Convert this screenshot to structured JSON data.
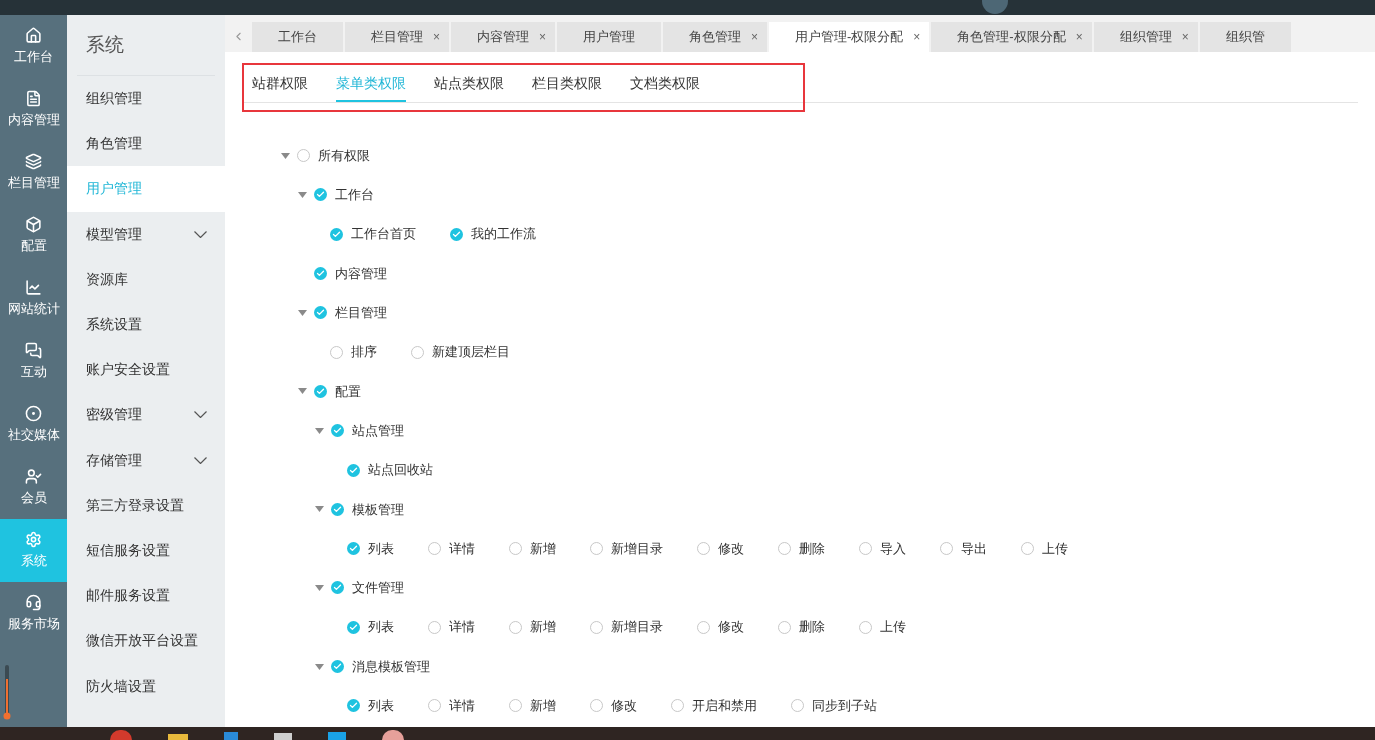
{
  "icon_rail": [
    {
      "label": "工作台",
      "selected": false
    },
    {
      "label": "内容管理",
      "selected": false
    },
    {
      "label": "栏目管理",
      "selected": false
    },
    {
      "label": "配置",
      "selected": false
    },
    {
      "label": "网站统计",
      "selected": false
    },
    {
      "label": "互动",
      "selected": false
    },
    {
      "label": "社交媒体",
      "selected": false
    },
    {
      "label": "会员",
      "selected": false
    },
    {
      "label": "系统",
      "selected": true
    },
    {
      "label": "服务市场",
      "selected": false
    }
  ],
  "sidebar": {
    "title": "系统",
    "items": [
      {
        "label": "组织管理",
        "selected": false
      },
      {
        "label": "角色管理",
        "selected": false
      },
      {
        "label": "用户管理",
        "selected": true
      },
      {
        "label": "模型管理",
        "selected": false,
        "expanded": false
      },
      {
        "label": "资源库",
        "selected": false
      },
      {
        "label": "系统设置",
        "selected": false
      },
      {
        "label": "账户安全设置",
        "selected": false
      },
      {
        "label": "密级管理",
        "selected": false,
        "expanded": false
      },
      {
        "label": "存储管理",
        "selected": false,
        "expanded": false
      },
      {
        "label": "第三方登录设置",
        "selected": false
      },
      {
        "label": "短信服务设置",
        "selected": false
      },
      {
        "label": "邮件服务设置",
        "selected": false
      },
      {
        "label": "微信开放平台设置",
        "selected": false
      },
      {
        "label": "防火墙设置",
        "selected": false
      }
    ]
  },
  "tabs": [
    {
      "label": "工作台",
      "selected": false
    },
    {
      "label": "栏目管理",
      "close": "×",
      "selected": false
    },
    {
      "label": "内容管理",
      "close": "×",
      "selected": false
    },
    {
      "label": "用户管理",
      "selected": false
    },
    {
      "label": "角色管理",
      "close": "×",
      "selected": false
    },
    {
      "label": "用户管理-权限分配",
      "close": "×",
      "selected": true
    },
    {
      "label": "角色管理-权限分配",
      "close": "×",
      "selected": false
    },
    {
      "label": "组织管理",
      "close": "×",
      "selected": false
    },
    {
      "label": "组织管",
      "selected": false
    }
  ],
  "subtabs": [
    {
      "label": "站群权限",
      "selected": false
    },
    {
      "label": "菜单类权限",
      "selected": true
    },
    {
      "label": "站点类权限",
      "selected": false
    },
    {
      "label": "栏目类权限",
      "selected": false
    },
    {
      "label": "文档类权限",
      "selected": false
    }
  ],
  "tree": [
    {
      "label": "所有权限",
      "checked": false,
      "expanded": true,
      "children": [
        {
          "label": "工作台",
          "checked": true,
          "expanded": true,
          "children": [
            {
              "label": "工作台首页",
              "checked": true
            },
            {
              "label": "我的工作流",
              "checked": true
            }
          ]
        },
        {
          "label": "内容管理",
          "checked": true
        },
        {
          "label": "栏目管理",
          "checked": true,
          "expanded": true,
          "children": [
            {
              "label": "排序",
              "checked": false
            },
            {
              "label": "新建顶层栏目",
              "checked": false
            }
          ]
        },
        {
          "label": "配置",
          "checked": true,
          "expanded": true,
          "children": [
            {
              "label": "站点管理",
              "checked": true,
              "expanded": true,
              "children": [
                {
                  "label": "站点回收站",
                  "checked": true
                }
              ]
            },
            {
              "label": "模板管理",
              "checked": true,
              "expanded": true,
              "children": [
                {
                  "label": "列表",
                  "checked": true
                },
                {
                  "label": "详情",
                  "checked": false
                },
                {
                  "label": "新增",
                  "checked": false
                },
                {
                  "label": "新增目录",
                  "checked": false
                },
                {
                  "label": "修改",
                  "checked": false
                },
                {
                  "label": "删除",
                  "checked": false
                },
                {
                  "label": "导入",
                  "checked": false
                },
                {
                  "label": "导出",
                  "checked": false
                },
                {
                  "label": "上传",
                  "checked": false
                }
              ]
            },
            {
              "label": "文件管理",
              "checked": true,
              "expanded": true,
              "children": [
                {
                  "label": "列表",
                  "checked": true
                },
                {
                  "label": "详情",
                  "checked": false
                },
                {
                  "label": "新增",
                  "checked": false
                },
                {
                  "label": "新增目录",
                  "checked": false
                },
                {
                  "label": "修改",
                  "checked": false
                },
                {
                  "label": "删除",
                  "checked": false
                },
                {
                  "label": "上传",
                  "checked": false
                }
              ]
            },
            {
              "label": "消息模板管理",
              "checked": true,
              "expanded": true,
              "children": [
                {
                  "label": "列表",
                  "checked": true
                },
                {
                  "label": "详情",
                  "checked": false
                },
                {
                  "label": "新增",
                  "checked": false
                },
                {
                  "label": "修改",
                  "checked": false
                },
                {
                  "label": "开启和禁用",
                  "checked": false
                },
                {
                  "label": "同步到子站",
                  "checked": false
                }
              ]
            }
          ]
        }
      ]
    }
  ]
}
